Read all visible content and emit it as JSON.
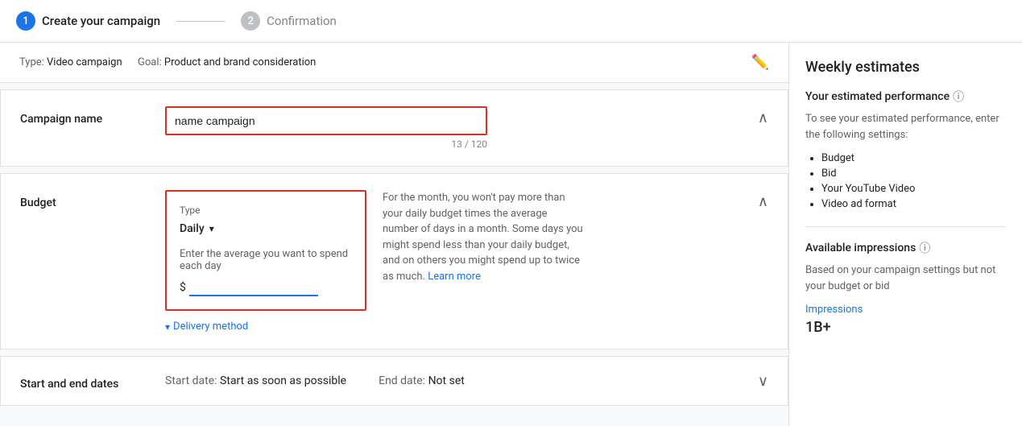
{
  "header": {
    "step1_number": "1",
    "step1_label": "Create your campaign",
    "step2_number": "2",
    "step2_label": "Confirmation"
  },
  "campaign_info_bar": {
    "type_label": "Type:",
    "type_value": "Video campaign",
    "goal_label": "Goal:",
    "goal_value": "Product and brand consideration"
  },
  "campaign_name": {
    "section_label": "Campaign name",
    "input_value": "name campaign",
    "char_count": "13 / 120"
  },
  "budget": {
    "section_label": "Budget",
    "box": {
      "type_label": "Type",
      "select_value": "Daily",
      "input_label": "Enter the average you want to spend each day",
      "currency_symbol": "$",
      "input_placeholder": ""
    },
    "description": "For the month, you won't pay more than your daily budget times the average number of days in a month. Some days you might spend less than your daily budget, and on others you might spend up to twice as much.",
    "learn_more": "Learn more",
    "delivery_method_label": "Delivery method"
  },
  "dates": {
    "section_label": "Start and end dates",
    "start_label": "Start date:",
    "start_value": "Start as soon as possible",
    "end_label": "End date:",
    "end_value": "Not set"
  },
  "sidebar": {
    "title": "Weekly estimates",
    "estimated_performance_label": "Your estimated performance",
    "estimated_performance_desc": "To see your estimated performance, enter the following settings:",
    "performance_items": [
      "Budget",
      "Bid",
      "Your YouTube Video",
      "Video ad format"
    ],
    "available_impressions_label": "Available impressions",
    "available_impressions_desc": "Based on your campaign settings but not your budget or bid",
    "impressions_label": "Impressions",
    "impressions_value": "1B+"
  }
}
